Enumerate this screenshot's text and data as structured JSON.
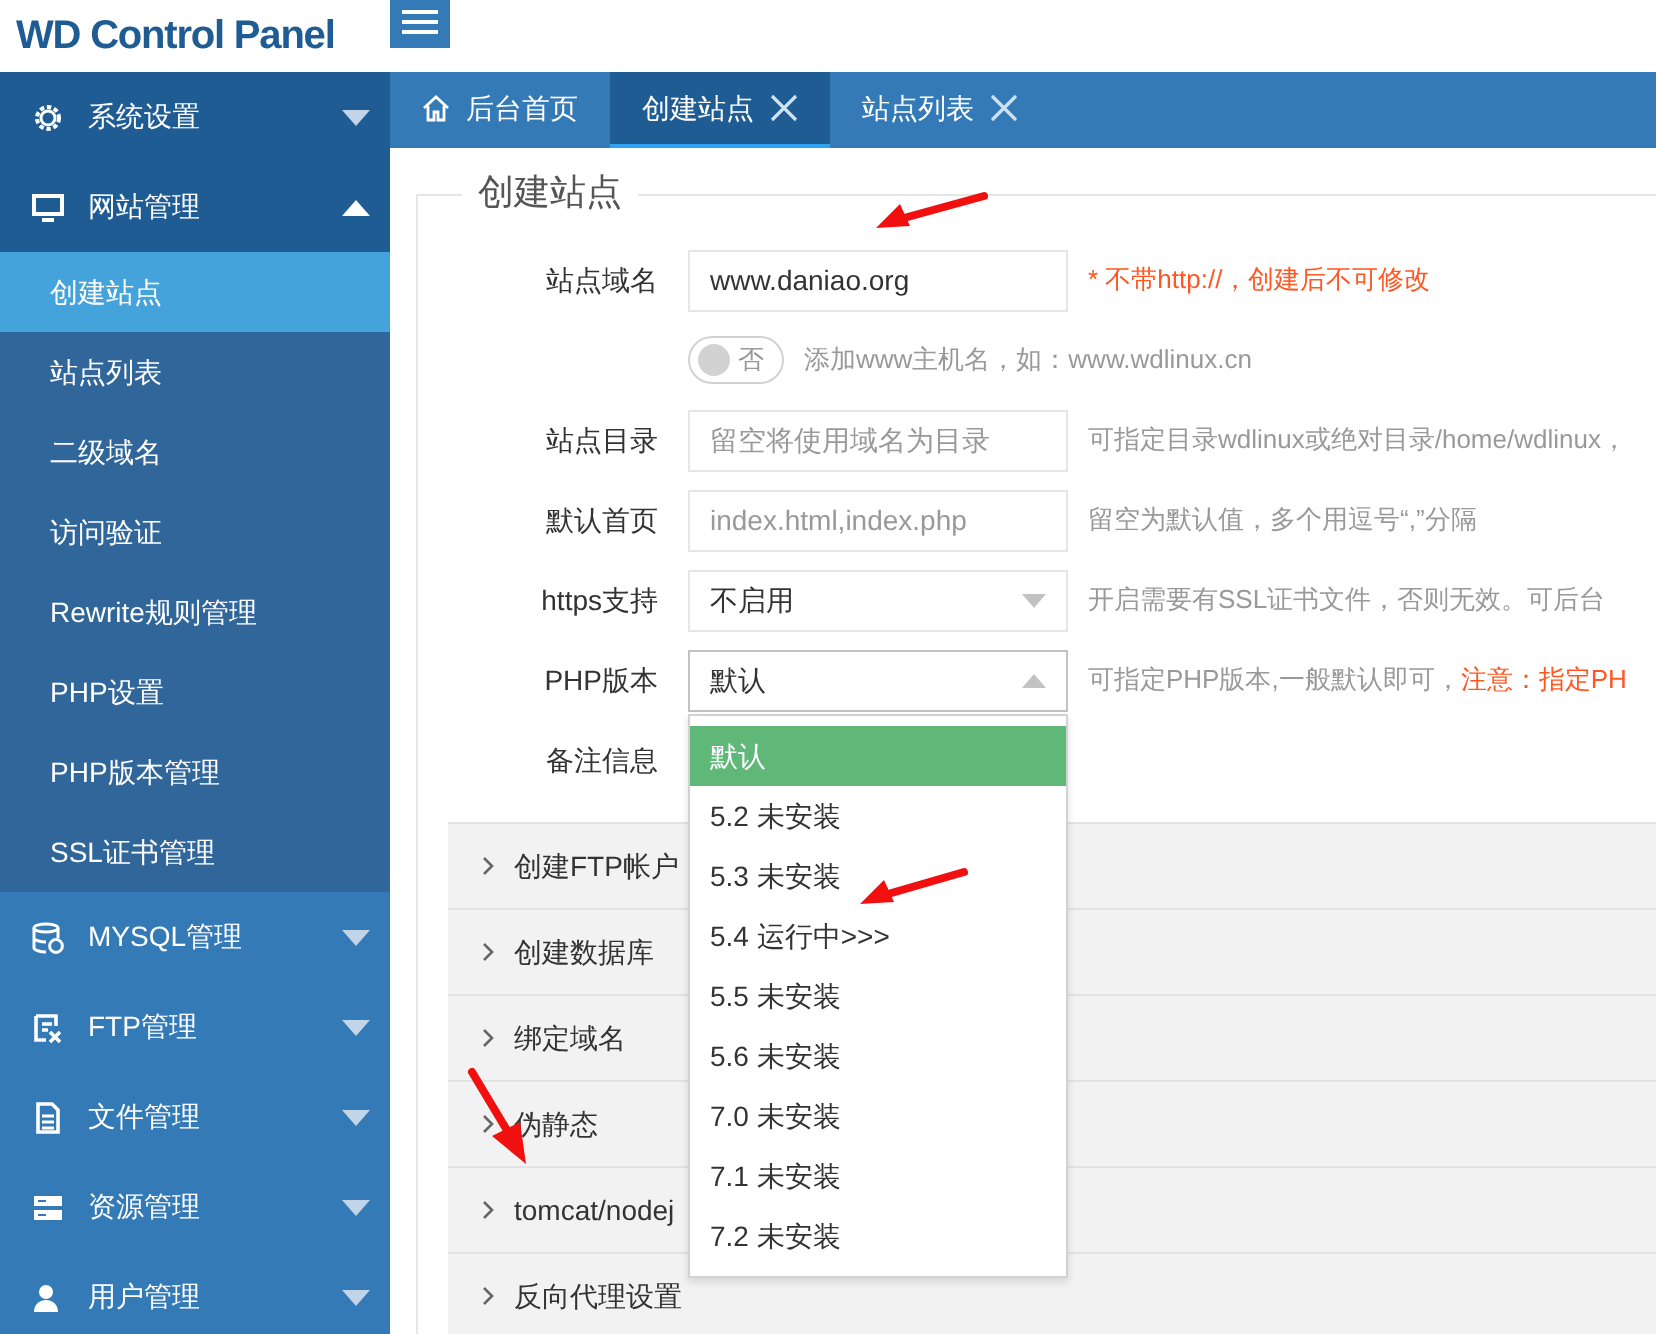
{
  "header": {
    "logo": "WD Control Panel"
  },
  "sidebar": {
    "groups": [
      {
        "label": "系统设置",
        "expanded": false,
        "highlighted": true
      },
      {
        "label": "网站管理",
        "expanded": true,
        "highlighted": true,
        "children": [
          {
            "label": "创建站点",
            "selected": true
          },
          {
            "label": "站点列表",
            "selected": false
          },
          {
            "label": "二级域名",
            "selected": false
          },
          {
            "label": "访问验证",
            "selected": false
          },
          {
            "label": "Rewrite规则管理",
            "selected": false
          },
          {
            "label": "PHP设置",
            "selected": false
          },
          {
            "label": "PHP版本管理",
            "selected": false
          },
          {
            "label": "SSL证书管理",
            "selected": false
          }
        ]
      },
      {
        "label": "MYSQL管理",
        "expanded": false,
        "highlighted": false
      },
      {
        "label": "FTP管理",
        "expanded": false,
        "highlighted": false
      },
      {
        "label": "文件管理",
        "expanded": false,
        "highlighted": false
      },
      {
        "label": "资源管理",
        "expanded": false,
        "highlighted": false
      },
      {
        "label": "用户管理",
        "expanded": false,
        "highlighted": false
      }
    ]
  },
  "tabs": [
    {
      "kind": "home",
      "label": "后台首页",
      "closable": false,
      "selected": false
    },
    {
      "kind": "page",
      "label": "创建站点",
      "closable": true,
      "selected": true
    },
    {
      "kind": "page",
      "label": "站点列表",
      "closable": true,
      "selected": false
    }
  ],
  "form": {
    "legend": "创建站点",
    "rows": [
      {
        "kind": "text",
        "label": "站点域名",
        "value": "www.daniao.org",
        "hint": "* 不带http://，创建后不可修改",
        "hint_warning": true
      },
      {
        "kind": "toggle",
        "on": false,
        "toggle_text": "否",
        "hint": "添加www主机名，如：www.wdlinux.cn",
        "hint_warning": false
      },
      {
        "kind": "text",
        "label": "站点目录",
        "placeholder": "留空将使用域名为目录",
        "hint": "可指定目录wdlinux或绝对目录/home/wdlinux，",
        "hint_warning": false
      },
      {
        "kind": "text",
        "label": "默认首页",
        "placeholder": "index.html,index.php",
        "hint": "留空为默认值，多个用逗号“,”分隔",
        "hint_warning": false
      },
      {
        "kind": "select",
        "label": "https支持",
        "value": "不启用",
        "open": false,
        "hint": "开启需要有SSL证书文件，否则无效。可后台",
        "hint_warning": false
      },
      {
        "kind": "select",
        "label": "PHP版本",
        "value": "默认",
        "open": true,
        "hint": "可指定PHP版本,一般默认即可，",
        "warning": "注意：指定PH",
        "hint_warning": false,
        "options": [
          {
            "label": "默认",
            "selected": true
          },
          {
            "label": "5.2 未安装",
            "selected": false
          },
          {
            "label": "5.3 未安装",
            "selected": false
          },
          {
            "label": "5.4 运行中>>>",
            "selected": false
          },
          {
            "label": "5.5 未安装",
            "selected": false
          },
          {
            "label": "5.6 未安装",
            "selected": false
          },
          {
            "label": "7.0 未安装",
            "selected": false
          },
          {
            "label": "7.1 未安装",
            "selected": false
          },
          {
            "label": "7.2 未安装",
            "selected": false
          }
        ]
      },
      {
        "kind": "label",
        "label": "备注信息"
      }
    ]
  },
  "sections": [
    {
      "label": "创建FTP帐户",
      "expanded": false
    },
    {
      "label": "创建数据库",
      "expanded": false
    },
    {
      "label": "绑定域名",
      "expanded": false
    },
    {
      "label": "伪静态",
      "expanded": false
    },
    {
      "label": "tomcat/nodej",
      "expanded": false
    },
    {
      "label": "反向代理设置",
      "expanded": false
    }
  ]
}
